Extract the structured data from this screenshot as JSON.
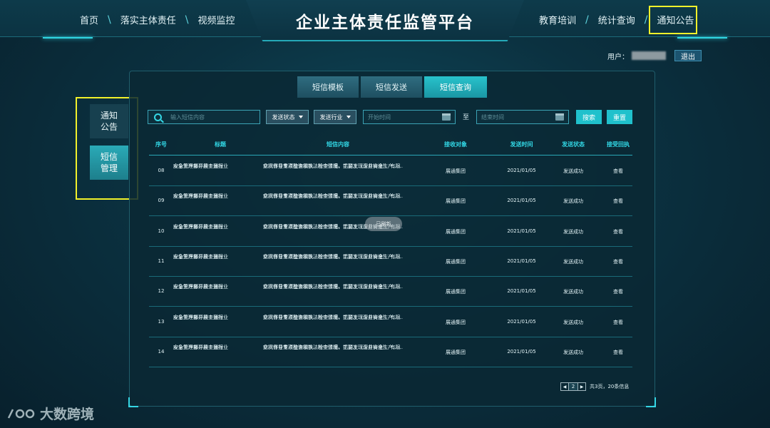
{
  "header": {
    "title": "企业主体责任监管平台",
    "nav_left": [
      "首页",
      "落实主体责任",
      "视频监控"
    ],
    "nav_right": [
      "教育培训",
      "统计查询",
      "通知公告"
    ],
    "separator": "\\",
    "separator_right": "/"
  },
  "user": {
    "label": "用户：",
    "logout": "退出"
  },
  "side_menu": {
    "items": [
      {
        "label": "通知\n公告",
        "active": false
      },
      {
        "label": "短信\n管理",
        "active": true
      }
    ]
  },
  "tabs": [
    {
      "label": "短信模板",
      "active": false
    },
    {
      "label": "短信发送",
      "active": false
    },
    {
      "label": "短信查询",
      "active": true
    }
  ],
  "filters": {
    "search_placeholder": "输入短信内容",
    "send_status": "发送状态",
    "send_industry": "发送行业",
    "start_placeholder": "开始时间",
    "to": "至",
    "end_placeholder": "结束时间",
    "search_btn": "搜索",
    "reset_btn": "重置"
  },
  "table": {
    "headers": [
      "序号",
      "标题",
      "短信内容",
      "接收对象",
      "发送时间",
      "发送状态",
      "接受回执"
    ],
    "rows": [
      {
        "idx": "08",
        "title1": "应急管理部开展工贸行业",
        "title2": "安全生产督导检查通报",
        "content1": "此次督导重点检查钢铁、粉尘涉爆、铝加工（深井铸造）、有限",
        "content2": "空间作业专项整治和执法检查情况，主要发现企业安全生产……",
        "receiver": "展通集团",
        "time": "2021/01/05",
        "status": "发送成功",
        "action": "查看"
      },
      {
        "idx": "09",
        "title1": "应急管理部开展工贸行业",
        "title2": "安全生产督导检查通报",
        "content1": "此次督导重点检查钢铁、粉尘涉爆、铝加工（深井铸造）、有限",
        "content2": "空间作业专项整治和执法检查情况，主要发现企业安全生产……",
        "receiver": "展通集团",
        "time": "2021/01/05",
        "status": "发送成功",
        "action": "查看"
      },
      {
        "idx": "10",
        "title1": "应急管理部开展工贸行业",
        "title2": "安全生产督导检查通报",
        "content1": "此次督导重点检查钢铁、粉尘涉爆、铝加工（深井铸造）、有限",
        "content2": "空间作业专项整治和执法检查情况，主要发现企业安全生产……",
        "receiver": "展通集团",
        "time": "2021/01/05",
        "status": "发送成功",
        "action": "查看"
      },
      {
        "idx": "11",
        "title1": "应急管理部开展工贸行业",
        "title2": "安全生产督导检查通报",
        "content1": "此次督导重点检查钢铁、粉尘涉爆、铝加工（深井铸造）、有限",
        "content2": "空间作业专项整治和执法检查情况，主要发现企业安全生产……",
        "receiver": "展通集团",
        "time": "2021/01/05",
        "status": "发送成功",
        "action": "查看"
      },
      {
        "idx": "12",
        "title1": "应急管理部开展工贸行业",
        "title2": "安全生产督导检查通报",
        "content1": "此次督导重点检查钢铁、粉尘涉爆、铝加工（深井铸造）、有限",
        "content2": "空间作业专项整治和执法检查情况，主要发现企业安全生产……",
        "receiver": "展通集团",
        "time": "2021/01/05",
        "status": "发送成功",
        "action": "查看"
      },
      {
        "idx": "13",
        "title1": "应急管理部开展工贸行业",
        "title2": "安全生产督导检查通报",
        "content1": "此次督导重点检查钢铁、粉尘涉爆、铝加工（深井铸造）、有限",
        "content2": "空间作业专项整治和执法检查情况，主要发现企业安全生产……",
        "receiver": "展通集团",
        "time": "2021/01/05",
        "status": "发送成功",
        "action": "查看"
      },
      {
        "idx": "14",
        "title1": "应急管理部开展工贸行业",
        "title2": "安全生产督导检查通报",
        "content1": "此次督导重点检查钢铁、粉尘涉爆、铝加工（深井铸造）、有限",
        "content2": "空间作业专项整治和执法检查情况，主要发现企业安全生产……",
        "receiver": "展通集团",
        "time": "2021/01/05",
        "status": "发送成功",
        "action": "查看"
      }
    ]
  },
  "floating_chip": "已刷新",
  "pagination": {
    "prev": "◀",
    "page": "2",
    "next": "▶",
    "info": "共3页，20条信息"
  },
  "watermark": "大数跨境",
  "colors": {
    "accent": "#2fd3e0",
    "highlight": "#f1f12a",
    "background": "#0b3140"
  }
}
